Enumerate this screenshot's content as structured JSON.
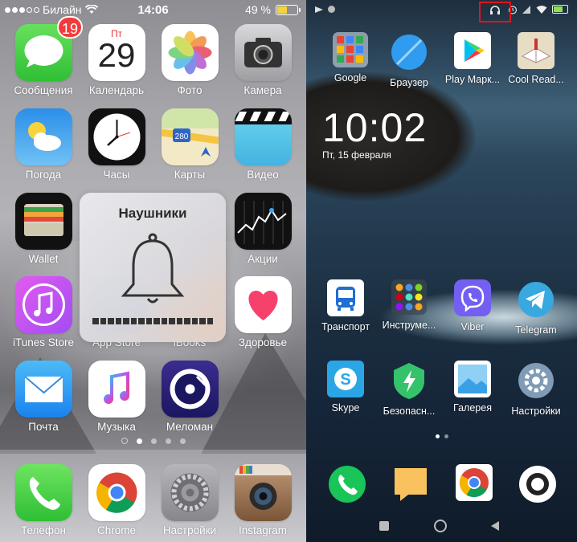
{
  "ios": {
    "status": {
      "carrier": "Билайн",
      "time": "14:06",
      "battery_pct": "49 %",
      "battery_level": 0.49
    },
    "grid": [
      {
        "label": "Сообщения",
        "icon": "messages-icon",
        "badge": "19"
      },
      {
        "label": "Календарь",
        "icon": "calendar-icon",
        "weekday": "Пт",
        "day": "29"
      },
      {
        "label": "Фото",
        "icon": "photos-icon"
      },
      {
        "label": "Камера",
        "icon": "camera-icon"
      },
      {
        "label": "Погода",
        "icon": "weather-icon"
      },
      {
        "label": "Часы",
        "icon": "clock-icon"
      },
      {
        "label": "Карты",
        "icon": "maps-icon",
        "road": "280"
      },
      {
        "label": "Видео",
        "icon": "video-icon"
      },
      {
        "label": "Wallet",
        "icon": "wallet-icon"
      },
      {
        "label": "Акции",
        "icon": "stocks-icon"
      },
      {
        "label": "iTunes Store",
        "icon": "itunes-icon"
      },
      {
        "label": "App Store",
        "icon": "appstore-icon"
      },
      {
        "label": "iBooks",
        "icon": "ibooks-icon"
      },
      {
        "label": "Здоровье",
        "icon": "health-icon"
      },
      {
        "label": "Почта",
        "icon": "mail-icon"
      },
      {
        "label": "Музыка",
        "icon": "music-icon"
      },
      {
        "label": "Меломан",
        "icon": "meloman-icon"
      }
    ],
    "dock": [
      {
        "label": "Телефон",
        "icon": "phone-icon"
      },
      {
        "label": "Chrome",
        "icon": "chrome-icon"
      },
      {
        "label": "Настройки",
        "icon": "settings-icon"
      },
      {
        "label": "Instagram",
        "icon": "instagram-icon"
      }
    ],
    "hud": {
      "title": "Наушники",
      "icon": "bell-icon"
    }
  },
  "android": {
    "clock": "10:02",
    "date": "Пт, 15 февраля",
    "top_row": [
      {
        "label": "Google",
        "icon": "google-folder-icon"
      },
      {
        "label": "Браузер",
        "icon": "browser-icon"
      },
      {
        "label": "Play Марк...",
        "icon": "play-store-icon"
      },
      {
        "label": "Cool Read...",
        "icon": "cool-reader-icon"
      }
    ],
    "row2": [
      {
        "label": "Транспорт",
        "icon": "transport-icon"
      },
      {
        "label": "Инструме...",
        "icon": "tools-folder-icon"
      },
      {
        "label": "Viber",
        "icon": "viber-icon"
      },
      {
        "label": "Telegram",
        "icon": "telegram-icon"
      }
    ],
    "row3": [
      {
        "label": "Skype",
        "icon": "skype-icon"
      },
      {
        "label": "Безопасн...",
        "icon": "security-icon"
      },
      {
        "label": "Галерея",
        "icon": "gallery-icon"
      },
      {
        "label": "Настройки",
        "icon": "settings-icon"
      }
    ],
    "dock": [
      {
        "icon": "phone-icon"
      },
      {
        "icon": "notes-icon"
      },
      {
        "icon": "chrome-icon"
      },
      {
        "icon": "camera-icon"
      }
    ],
    "status_icons": [
      "cast-icon",
      "headphones-icon",
      "alarm-icon",
      "signal-icon",
      "wifi-icon",
      "battery-icon"
    ],
    "highlight_color": "#e0141d"
  }
}
